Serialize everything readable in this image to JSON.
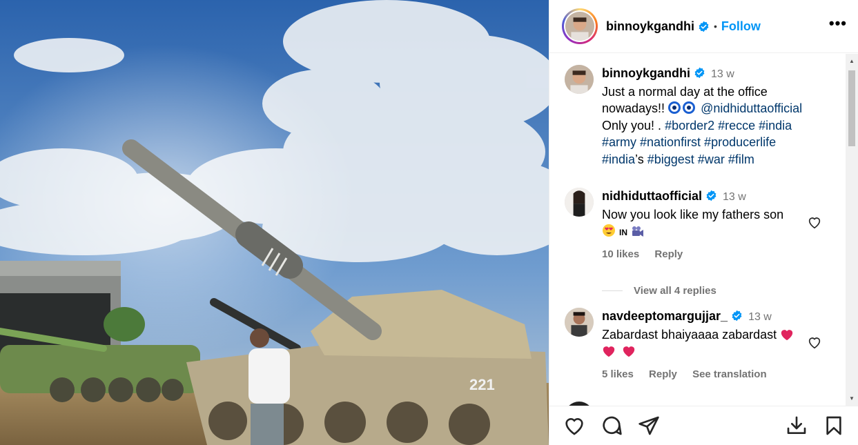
{
  "post": {
    "username": "binnoykgandhi",
    "follow_label": "Follow",
    "separator": "•",
    "more_label": "•••"
  },
  "caption": {
    "username": "binnoykgandhi",
    "time": "13 w",
    "text_start": "Just a normal day at the office nowadays!!",
    "mention": "@nidhiduttaofficial",
    "text_mid": "Only you! .",
    "tags_1": "#border2 #recce #india",
    "tags_2": "#army #nationfirst #producerlife",
    "tag_india": "#india",
    "apostrophe_s": "’s",
    "tags_3": "#biggest #war #film"
  },
  "comments": [
    {
      "username": "nidhiduttaofficial",
      "time": "13 w",
      "text": "Now you look like my fathers son",
      "text_tail": "IN",
      "likes": "10 likes",
      "reply_label": "Reply",
      "view_replies": "View all 4 replies"
    },
    {
      "username": "navdeeptomargujjar_",
      "time": "13 w",
      "text": "Zabardast bhaiyaaaa zabardast",
      "likes": "5 likes",
      "reply_label": "Reply",
      "translation_label": "See translation"
    }
  ],
  "icons": {
    "like": "heart-icon",
    "comment": "comment-icon",
    "share": "share-icon",
    "download": "download-icon",
    "save": "bookmark-icon"
  },
  "colors": {
    "link": "#0095f6",
    "hashtag": "#00376b",
    "muted": "#737373"
  }
}
